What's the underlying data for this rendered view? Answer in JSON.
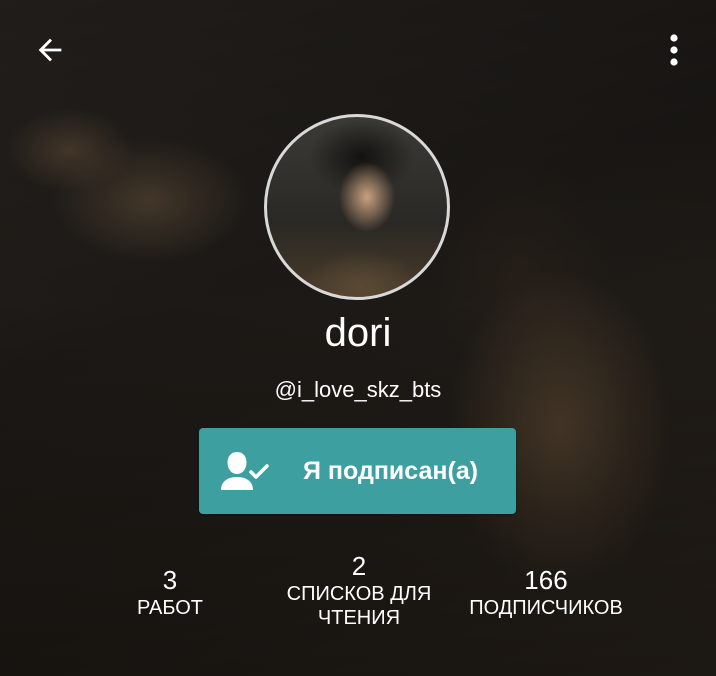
{
  "header": {
    "back_icon": "arrow-left-icon",
    "menu_icon": "more-vertical-icon"
  },
  "profile": {
    "display_name": "dori",
    "username": "@i_love_skz_bts"
  },
  "follow_button": {
    "label": "Я подписан(а)",
    "icon": "user-check-icon",
    "color": "#3d9fa0"
  },
  "stats": {
    "works": {
      "value": "3",
      "label": "РАБОТ"
    },
    "reading_lists": {
      "value": "2",
      "label_line1": "СПИСКОВ ДЛЯ",
      "label_line2": "ЧТЕНИЯ"
    },
    "followers": {
      "value": "166",
      "label": "ПОДПИСЧИКОВ"
    }
  }
}
